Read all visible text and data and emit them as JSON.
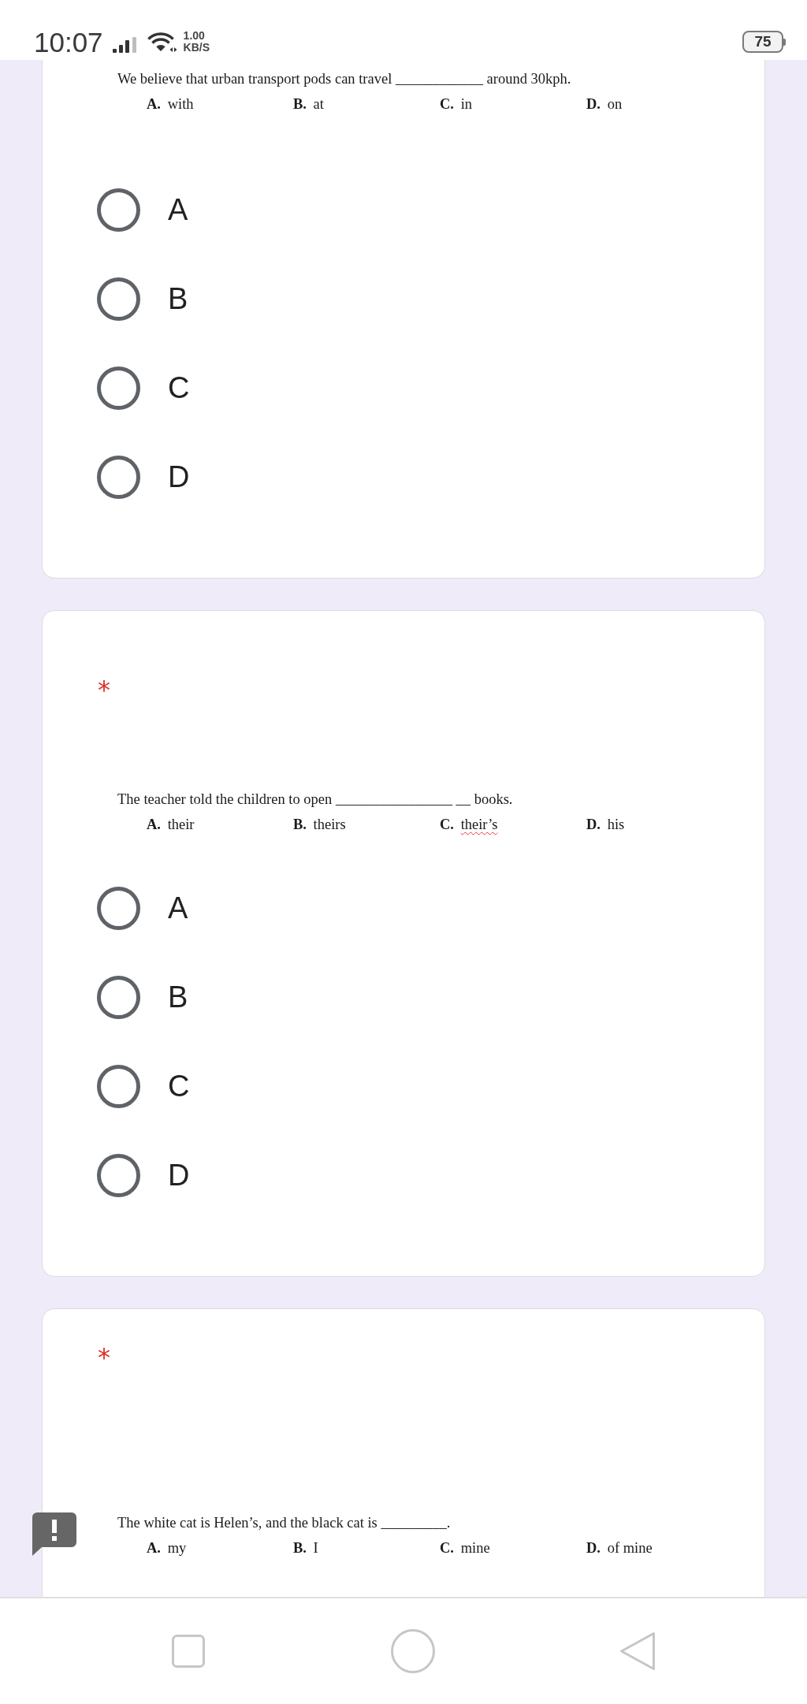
{
  "status_bar": {
    "time": "10:07",
    "speed_value": "1.00",
    "speed_unit": "KB/S",
    "battery": "75"
  },
  "questions": [
    {
      "question": "We believe that urban transport pods can travel ____________ around 30kph.",
      "options": [
        {
          "letter": "A.",
          "text": "with",
          "misspelled": false
        },
        {
          "letter": "B.",
          "text": "at",
          "misspelled": false
        },
        {
          "letter": "C.",
          "text": "in",
          "misspelled": false
        },
        {
          "letter": "D.",
          "text": "on",
          "misspelled": false
        }
      ],
      "choices": [
        {
          "label": "A",
          "selected": false
        },
        {
          "label": "B",
          "selected": false
        },
        {
          "label": "C",
          "selected": false
        },
        {
          "label": "D",
          "selected": false
        }
      ]
    },
    {
      "required_mark": "*",
      "question": "The teacher told the children to open ________________ __ books.",
      "options": [
        {
          "letter": "A.",
          "text": "their",
          "misspelled": false
        },
        {
          "letter": "B.",
          "text": "theirs",
          "misspelled": false
        },
        {
          "letter": "C.",
          "text": "their’s",
          "misspelled": true
        },
        {
          "letter": "D.",
          "text": "his",
          "misspelled": false
        }
      ],
      "choices": [
        {
          "label": "A",
          "selected": false
        },
        {
          "label": "B",
          "selected": false
        },
        {
          "label": "C",
          "selected": false
        },
        {
          "label": "D",
          "selected": false
        }
      ]
    },
    {
      "required_mark": "*",
      "question": "The white cat is Helen’s, and the black cat is _________.",
      "options": [
        {
          "letter": "A.",
          "text": "my",
          "misspelled": false
        },
        {
          "letter": "B.",
          "text": "I",
          "misspelled": false
        },
        {
          "letter": "C.",
          "text": "mine",
          "misspelled": false
        },
        {
          "letter": "D.",
          "text": "of mine",
          "misspelled": false
        }
      ]
    }
  ]
}
